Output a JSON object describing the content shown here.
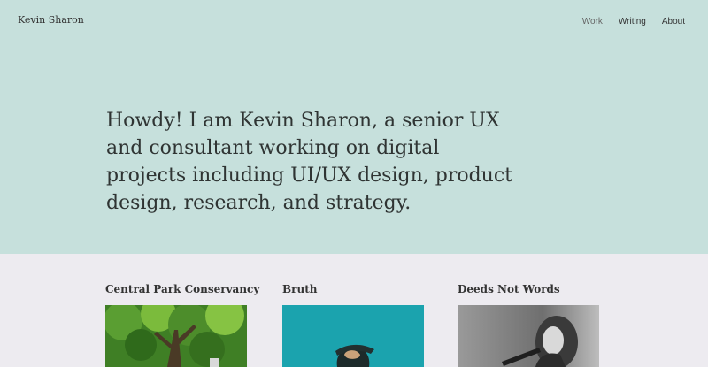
{
  "header": {
    "site_name": "Kevin Sharon",
    "nav": [
      {
        "label": "Work",
        "active": true
      },
      {
        "label": "Writing",
        "active": false
      },
      {
        "label": "About",
        "active": false
      }
    ]
  },
  "hero": {
    "intro": "Howdy! I am Kevin Sharon, a senior UX and consultant working on digital projects including UI/UX design, product design, research, and strategy."
  },
  "projects": [
    {
      "title": "Central Park Conservancy"
    },
    {
      "title": "Bruth"
    },
    {
      "title": "Deeds Not Words"
    }
  ],
  "colors": {
    "hero_bg": "#c6e0dc",
    "page_bg": "#edebf0",
    "text": "#2f3433"
  }
}
